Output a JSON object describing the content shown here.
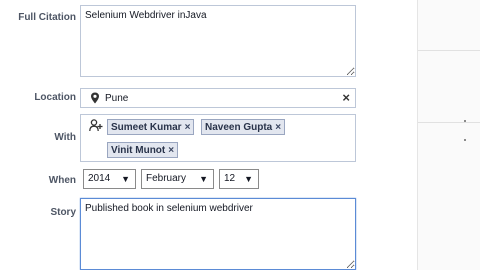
{
  "form": {
    "full_citation": {
      "label": "Full Citation",
      "value": "Selenium Webdriver inJava"
    },
    "location": {
      "label": "Location",
      "value": "Pune",
      "clear_glyph": "×",
      "icon": "map-pin-icon"
    },
    "with": {
      "label": "With",
      "icon": "add-friend-icon",
      "tokens": [
        {
          "name": "Sumeet Kumar",
          "remove": "×"
        },
        {
          "name": "Naveen Gupta",
          "remove": "×"
        },
        {
          "name": "Vinit Munot",
          "remove": "×"
        }
      ]
    },
    "when": {
      "label": "When",
      "year": "2014",
      "month": "February",
      "day": "12",
      "arrow": "▼"
    },
    "story": {
      "label": "Story",
      "value": "Published book in selenium webdriver"
    }
  },
  "colors": {
    "label": "#4e5665",
    "input_border": "#bdc7d8",
    "focus_border": "#5b8bd6",
    "token_bg": "#e2e6ef"
  }
}
